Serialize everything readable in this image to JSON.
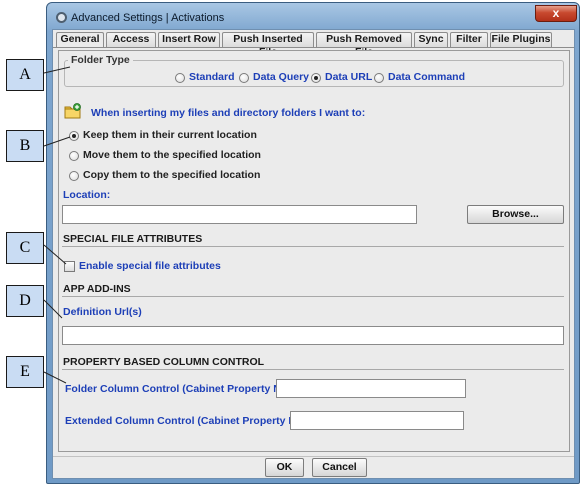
{
  "window": {
    "title": "Advanced Settings | Activations",
    "close_glyph": "x"
  },
  "tabs": [
    {
      "label": "General",
      "active": true
    },
    {
      "label": "Access"
    },
    {
      "label": "Insert Row"
    },
    {
      "label": "Push Inserted File"
    },
    {
      "label": "Push Removed File"
    },
    {
      "label": "Sync"
    },
    {
      "label": "Filter"
    },
    {
      "label": "File Plugins"
    }
  ],
  "folder_type": {
    "legend": "Folder Type",
    "options": [
      {
        "label": "Standard",
        "checked": false
      },
      {
        "label": "Data Query",
        "checked": false
      },
      {
        "label": "Data URL",
        "checked": true
      },
      {
        "label": "Data Command",
        "checked": false
      }
    ]
  },
  "insert_behavior": {
    "prompt": "When inserting my files and directory folders I want to:",
    "icon": "folder-add-icon",
    "options": [
      {
        "label": "Keep them in their current location",
        "checked": true
      },
      {
        "label": "Move them to the specified location",
        "checked": false
      },
      {
        "label": "Copy them to the specified location",
        "checked": false
      }
    ],
    "location_label": "Location:",
    "location_value": "",
    "browse_label": "Browse..."
  },
  "special_file_attributes": {
    "header": "SPECIAL FILE ATTRIBUTES",
    "checkbox_label": "Enable special file attributes",
    "checked": false
  },
  "app_addins": {
    "header": "APP ADD-INS",
    "definition_label": "Definition Url(s)",
    "definition_value": ""
  },
  "column_control": {
    "header": "PROPERTY BASED COLUMN CONTROL",
    "folder_label": "Folder Column Control (Cabinet Property Name)",
    "folder_value": "",
    "extended_label": "Extended Column Control (Cabinet Property Name)",
    "extended_value": ""
  },
  "footer": {
    "ok_label": "OK",
    "cancel_label": "Cancel"
  },
  "callouts": [
    "A",
    "B",
    "C",
    "D",
    "E"
  ],
  "colors": {
    "accent_blue_text": "#1d3fb7",
    "callout_fill": "#c9dcf3",
    "title_bar": "#7ea6cf",
    "close_button": "#c8492f"
  }
}
